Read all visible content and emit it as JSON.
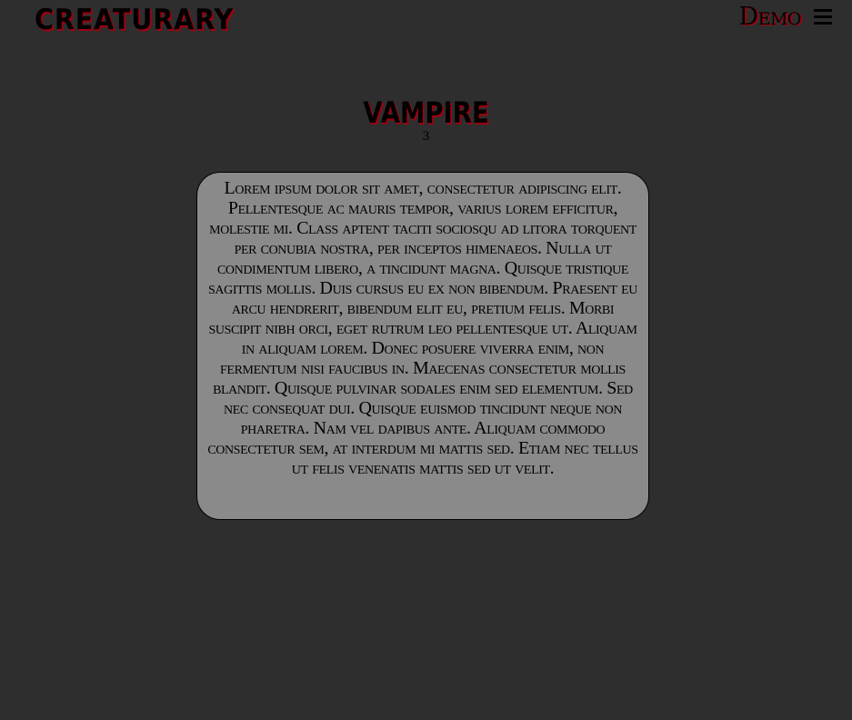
{
  "header": {
    "logo_text": "Creaturary",
    "nav_demo_label": "Demo",
    "menu_icon": "hamburger-menu-icon"
  },
  "main": {
    "title": "Vampire",
    "page_number": "3",
    "description": "Lorem ipsum dolor sit amet, consectetur adipiscing elit. Pellentesque ac mauris tempor, varius lorem efficitur, molestie mi. Class aptent taciti sociosqu ad litora torquent per conubia nostra, per inceptos himenaeos. Nulla ut condimentum libero, a tincidunt magna. Quisque tristique sagittis mollis. Duis cursus eu ex non bibendum. Praesent eu arcu hendrerit, bibendum elit eu, pretium felis. Morbi suscipit nibh orci, eget rutrum leo pellentesque ut. Aliquam in aliquam lorem. Donec posuere viverra enim, non fermentum nisi faucibus in. Maecenas consectetur mollis blandit. Quisque pulvinar sodales enim sed elementum. Sed nec consequat dui. Quisque euismod tincidunt neque non pharetra. Nam vel dapibus ante. Aliquam commodo consectetur sem, at interdum mi mattis sed. Etiam nec tellus ut felis venenatis mattis sed ut velit."
  },
  "colors": {
    "background": "#2e2e2e",
    "card_background": "#8a8a8a",
    "accent_shadow": "#a00010",
    "text": "#000000"
  }
}
